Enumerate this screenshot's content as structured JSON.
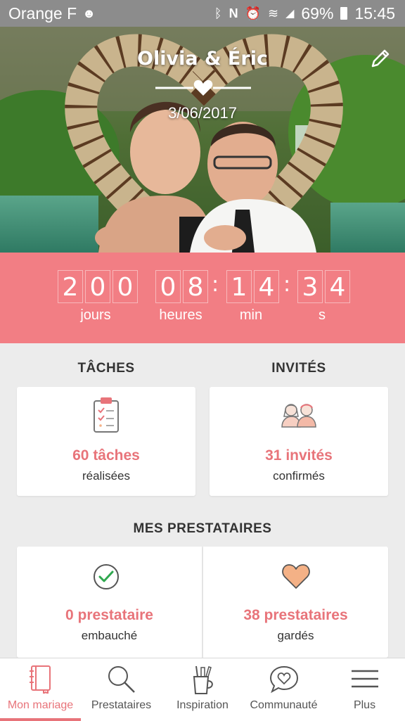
{
  "status_bar": {
    "carrier": "Orange F",
    "battery": "69%",
    "time": "15:45"
  },
  "hero": {
    "title": "Olivia & Éric",
    "date": "3/06/2017"
  },
  "countdown": {
    "days_digits": [
      "2",
      "0",
      "0"
    ],
    "hours_digits": [
      "0",
      "8"
    ],
    "min_digits": [
      "1",
      "4"
    ],
    "sec_digits": [
      "3",
      "4"
    ],
    "labels": {
      "days": "jours",
      "hours": "heures",
      "min": "min",
      "sec": "s"
    }
  },
  "tasks": {
    "title": "TÂCHES",
    "count": "60 tâches",
    "caption": "réalisées"
  },
  "guests": {
    "title": "INVITÉS",
    "count": "31 invités",
    "caption": "confirmés"
  },
  "vendors": {
    "title": "MES PRESTATAIRES",
    "hired": {
      "count": "0 prestataire",
      "caption": "embauché"
    },
    "saved": {
      "count": "38 prestataires",
      "caption": "gardés"
    }
  },
  "nav": [
    {
      "label": "Mon mariage",
      "icon": "notebook-icon",
      "active": true
    },
    {
      "label": "Prestataires",
      "icon": "search-icon"
    },
    {
      "label": "Inspiration",
      "icon": "inspiration-icon"
    },
    {
      "label": "Communauté",
      "icon": "community-icon"
    },
    {
      "label": "Plus",
      "icon": "menu-icon"
    }
  ],
  "colors": {
    "accent": "#f27e84",
    "accent_text": "#e8747a"
  }
}
